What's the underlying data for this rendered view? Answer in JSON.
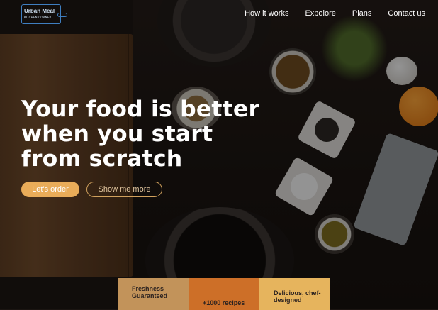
{
  "brand": {
    "logo_title": "Urban Meal",
    "logo_subtitle": "KITCHEN CORNER"
  },
  "nav": {
    "items": [
      "How it works",
      "Expolore",
      "Plans",
      "Contact us"
    ]
  },
  "hero": {
    "title": "Your food is better when you start from scratch",
    "primary_button": "Let's order",
    "secondary_button": "Show me more"
  },
  "features": {
    "cards": [
      {
        "label": "Freshness Guaranteed"
      },
      {
        "label": "+1000 recipes"
      },
      {
        "label": "Delicious, chef-designed"
      }
    ]
  },
  "colors": {
    "accent": "#e9ac59",
    "card_1": "#c2935a",
    "card_2": "#cd6f28",
    "card_3": "#e6b45d"
  }
}
